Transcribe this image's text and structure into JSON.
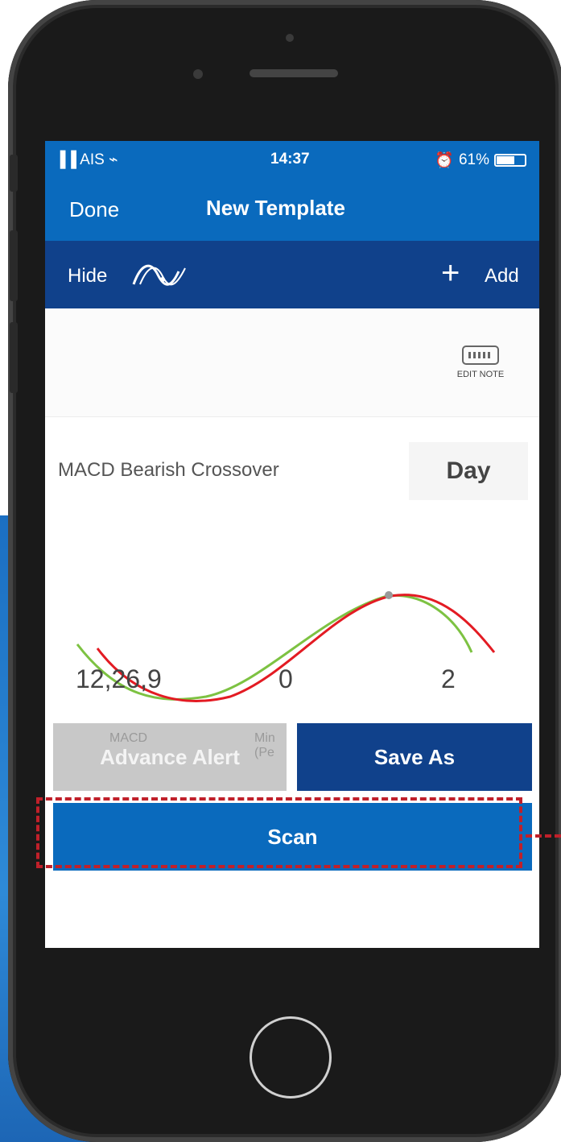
{
  "status_bar": {
    "carrier": "AIS",
    "time": "14:37",
    "battery": "61%"
  },
  "nav": {
    "done_label": "Done",
    "title": "New Template"
  },
  "toolbar": {
    "hide_label": "Hide",
    "add_label": "Add"
  },
  "edit_note": {
    "label": "EDIT NOTE"
  },
  "indicator": {
    "name": "MACD Bearish Crossover",
    "period": "Day"
  },
  "params": [
    {
      "value": "12,26,9",
      "caption": "MACD"
    },
    {
      "value": "0",
      "caption": "Min (Pe"
    },
    {
      "value": "2",
      "caption": ""
    }
  ],
  "buttons": {
    "advance_alert": "Advance Alert",
    "save_as": "Save As",
    "scan": "Scan"
  },
  "colors": {
    "primary_blue": "#0a6abd",
    "dark_blue": "#10418b",
    "macd_line": "#e31b23",
    "signal_line": "#7dc242",
    "highlight_dash": "#c0202a"
  }
}
